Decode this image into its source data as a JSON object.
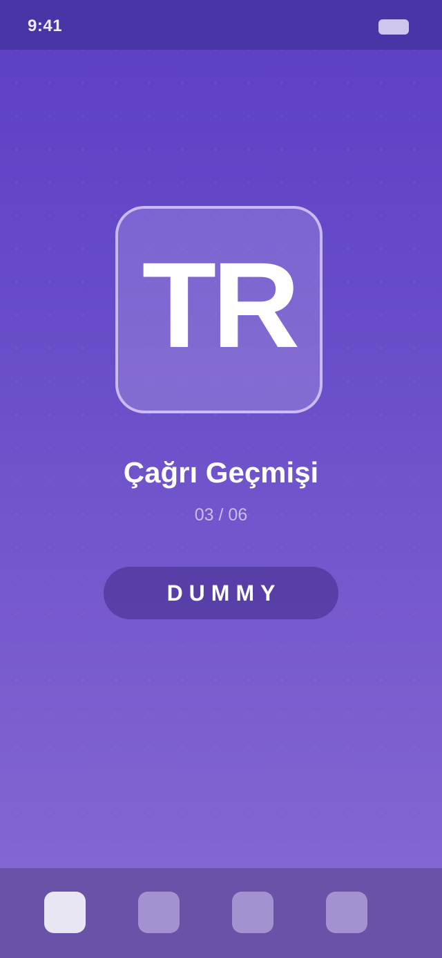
{
  "status_bar": {
    "time": "9:41",
    "battery_icon": "battery-icon"
  },
  "card": {
    "tile_text": "TR",
    "title": "Çağrı Geçmişi",
    "counter": "03 / 06"
  },
  "action": {
    "label": "DUMMY"
  },
  "tab_bar": {
    "tabs": [
      {
        "icon": "tab-icon",
        "active": true
      },
      {
        "icon": "tab-icon",
        "active": false
      },
      {
        "icon": "tab-icon",
        "active": false
      },
      {
        "icon": "tab-icon",
        "active": false
      }
    ]
  },
  "colors": {
    "background_top": "#5c3fc4",
    "background_bottom": "#866bd3",
    "status_bar": "#4b34a6",
    "tab_bar": "#6953a8",
    "active_tab": "#e9e6f4"
  }
}
